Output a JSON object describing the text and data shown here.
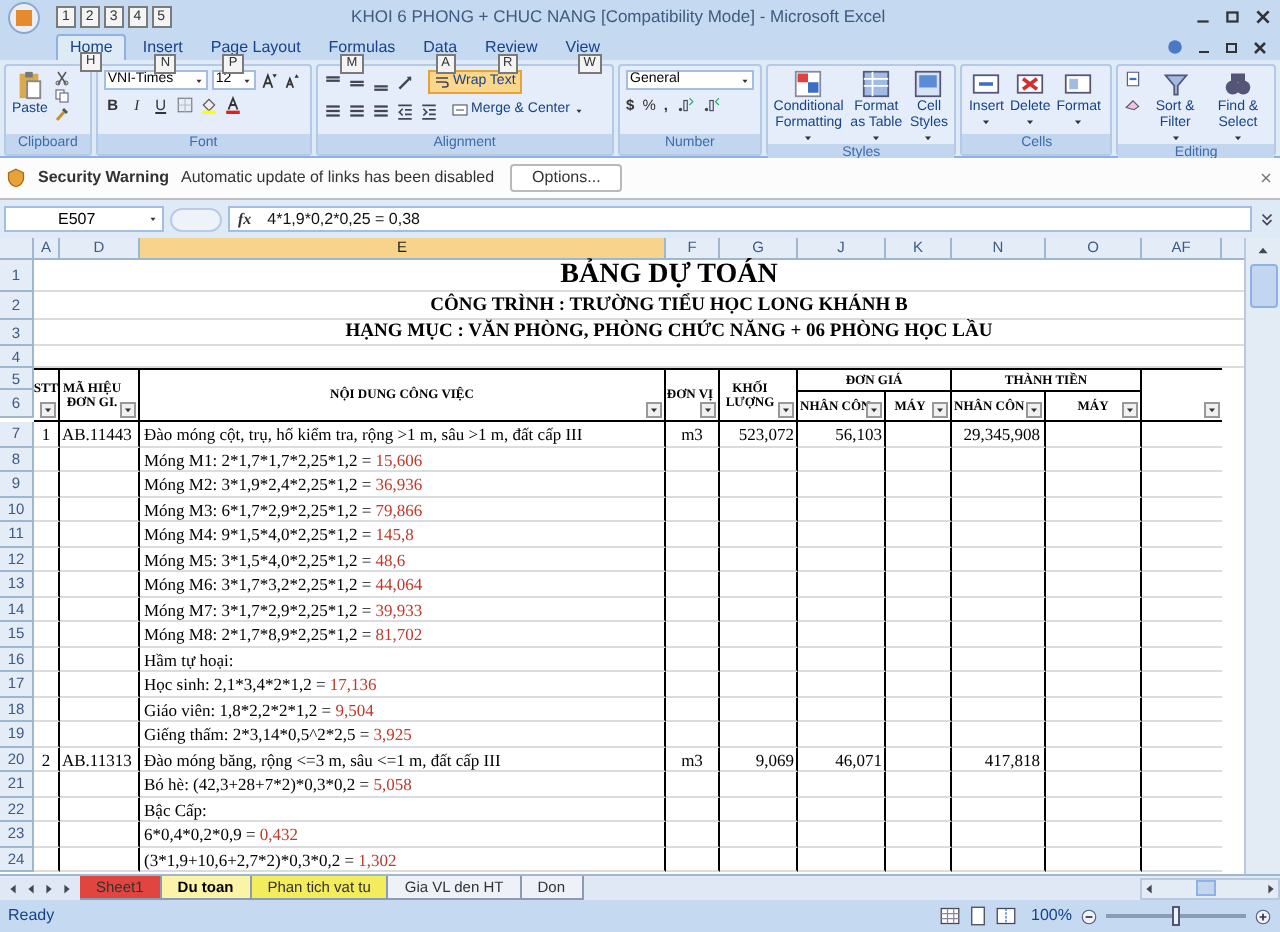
{
  "window": {
    "title": "KHOI 6 PHONG + CHUC NANG  [Compatibility Mode] - Microsoft Excel"
  },
  "quick_access_keytips": [
    "1",
    "2",
    "3",
    "4",
    "5"
  ],
  "ribbon": {
    "tabs": [
      {
        "label": "Home",
        "keytip": "H",
        "selected": true
      },
      {
        "label": "Insert",
        "keytip": "N",
        "selected": false
      },
      {
        "label": "Page Layout",
        "keytip": "P",
        "selected": false
      },
      {
        "label": "Formulas",
        "keytip": "M",
        "selected": false
      },
      {
        "label": "Data",
        "keytip": "A",
        "selected": false
      },
      {
        "label": "Review",
        "keytip": "R",
        "selected": false
      },
      {
        "label": "View",
        "keytip": "W",
        "selected": false
      }
    ],
    "clipboard": {
      "label": "Clipboard",
      "paste": "Paste"
    },
    "font": {
      "label": "Font",
      "name": "VNI-Times",
      "size": "12",
      "bold": "B",
      "italic": "I",
      "underline": "U"
    },
    "alignment": {
      "label": "Alignment",
      "wrap_text": {
        "label": "Wrap Text",
        "on": true
      },
      "merge": "Merge & Center"
    },
    "number": {
      "label": "Number",
      "format": "General",
      "currency": "$",
      "percent": "%",
      "comma": ","
    },
    "styles": {
      "label": "Styles",
      "buttons": [
        "Conditional Formatting",
        "Format as Table",
        "Cell Styles"
      ]
    },
    "cells": {
      "label": "Cells",
      "buttons": [
        "Insert",
        "Delete",
        "Format"
      ]
    },
    "editing": {
      "label": "Editing",
      "buttons": [
        "Sort & Filter",
        "Find & Select"
      ]
    }
  },
  "security_bar": {
    "title": "Security Warning",
    "message": "Automatic update of links has been disabled",
    "button": "Options..."
  },
  "formula_bar": {
    "name_box": "E507",
    "fx": "fx",
    "formula": "4*1,9*0,2*0,25 = 0,38"
  },
  "sheet": {
    "columns": [
      {
        "label": "A",
        "selected": false
      },
      {
        "label": "D",
        "selected": false
      },
      {
        "label": "E",
        "selected": true
      },
      {
        "label": "F",
        "selected": false
      },
      {
        "label": "G",
        "selected": false
      },
      {
        "label": "J",
        "selected": false
      },
      {
        "label": "K",
        "selected": false
      },
      {
        "label": "N",
        "selected": false
      },
      {
        "label": "O",
        "selected": false
      },
      {
        "label": "AF",
        "selected": false
      }
    ],
    "title_lines": [
      {
        "row": "1",
        "text": "BẢNG DỰ TOÁN"
      },
      {
        "row": "2",
        "text": "CÔNG TRÌNH : TRƯỜNG TIỂU HỌC LONG KHÁNH B"
      },
      {
        "row": "3",
        "text": "HẠNG MỤC : VĂN PHÒNG, PHÒNG CHỨC NĂNG + 06 PHÒNG HỌC LẦU"
      },
      {
        "row": "4"
      }
    ],
    "header": {
      "rows": [
        "5",
        "6"
      ],
      "stt": "STT",
      "code": "MÃ HIỆU ĐƠN GI.",
      "content": "NỘI DUNG CÔNG VIỆC",
      "unit": "ĐƠN VỊ",
      "quantity": "KHỐI LƯỢNG",
      "unit_price": "ĐƠN GIÁ",
      "unit_price_labor": "NHÂN CÔN",
      "unit_price_machine": "MÁY",
      "total": "THÀNH TIỀN",
      "total_labor": "NHÂN CÔN",
      "total_machine": "MÁY"
    },
    "rows": [
      {
        "row": "7",
        "stt": "1",
        "code": "AB.11443",
        "content": "Đào móng cột, trụ, hố kiểm tra, rộng >1 m, sâu >1 m, đất cấp III",
        "unit": "m3",
        "quantity": "523,072",
        "unit_price_labor": "56,103",
        "total_labor": "29,345,908"
      },
      {
        "row": "8",
        "content": [
          {
            "kind": "text",
            "text": "Móng M1: 2*1,7*1,7*2,25*1,2 = "
          },
          {
            "kind": "result",
            "text": "15,606"
          }
        ]
      },
      {
        "row": "9",
        "content": [
          {
            "kind": "text",
            "text": "Móng M2: 3*1,9*2,4*2,25*1,2 = "
          },
          {
            "kind": "result",
            "text": "36,936"
          }
        ]
      },
      {
        "row": "10",
        "content": [
          {
            "kind": "text",
            "text": "Móng M3: 6*1,7*2,9*2,25*1,2 = "
          },
          {
            "kind": "result",
            "text": "79,866"
          }
        ]
      },
      {
        "row": "11",
        "content": [
          {
            "kind": "text",
            "text": "Móng M4: 9*1,5*4,0*2,25*1,2 = "
          },
          {
            "kind": "result",
            "text": "145,8"
          }
        ]
      },
      {
        "row": "12",
        "content": [
          {
            "kind": "text",
            "text": "Móng M5: 3*1,5*4,0*2,25*1,2 = "
          },
          {
            "kind": "result",
            "text": "48,6"
          }
        ]
      },
      {
        "row": "13",
        "content": [
          {
            "kind": "text",
            "text": "Móng M6: 3*1,7*3,2*2,25*1,2 = "
          },
          {
            "kind": "result",
            "text": "44,064"
          }
        ]
      },
      {
        "row": "14",
        "content": [
          {
            "kind": "text",
            "text": "Móng M7: 3*1,7*2,9*2,25*1,2 = "
          },
          {
            "kind": "result",
            "text": "39,933"
          }
        ]
      },
      {
        "row": "15",
        "content": [
          {
            "kind": "text",
            "text": "Móng M8: 2*1,7*8,9*2,25*1,2 = "
          },
          {
            "kind": "result",
            "text": "81,702"
          }
        ]
      },
      {
        "row": "16",
        "content": "Hầm tự hoại:"
      },
      {
        "row": "17",
        "content": [
          {
            "kind": "text",
            "text": "Học sinh: 2,1*3,4*2*1,2 = "
          },
          {
            "kind": "result",
            "text": "17,136"
          }
        ]
      },
      {
        "row": "18",
        "content": [
          {
            "kind": "text",
            "text": "Giáo viên: 1,8*2,2*2*1,2 = "
          },
          {
            "kind": "result",
            "text": "9,504"
          }
        ]
      },
      {
        "row": "19",
        "content": [
          {
            "kind": "text",
            "text": "Giếng thấm: 2*3,14*0,5^2*2,5 = "
          },
          {
            "kind": "result",
            "text": "3,925"
          }
        ]
      },
      {
        "row": "20",
        "stt": "2",
        "code": "AB.11313",
        "content": "Đào móng băng, rộng <=3 m, sâu <=1 m, đất cấp III",
        "unit": "m3",
        "quantity": "9,069",
        "unit_price_labor": "46,071",
        "total_labor": "417,818"
      },
      {
        "row": "21",
        "content": [
          {
            "kind": "text",
            "text": "Bó hè: (42,3+28+7*2)*0,3*0,2 = "
          },
          {
            "kind": "result",
            "text": "5,058"
          }
        ]
      },
      {
        "row": "22",
        "content": "Bậc Cấp:"
      },
      {
        "row": "23",
        "content": [
          {
            "kind": "text",
            "text": "6*0,4*0,2*0,9 = "
          },
          {
            "kind": "result",
            "text": "0,432"
          }
        ]
      },
      {
        "row": "24",
        "content": [
          {
            "kind": "text",
            "text": "(3*1,9+10,6+2,7*2)*0,3*0,2 = "
          },
          {
            "kind": "result",
            "text": "1,302"
          }
        ]
      }
    ]
  },
  "sheet_tabs": [
    {
      "label": "Sheet1",
      "selected": false,
      "color": "#e0453f"
    },
    {
      "label": "Du toan",
      "selected": true,
      "color": "#fbf3a8"
    },
    {
      "label": "Phan tich vat tu",
      "selected": false,
      "color": "#f3ec5c"
    },
    {
      "label": "Gia VL den HT",
      "selected": false
    },
    {
      "label": "Don",
      "selected": false
    }
  ],
  "status_bar": {
    "status": "Ready",
    "zoom": "100%",
    "zoom_slider": {
      "level": 0.5
    }
  }
}
